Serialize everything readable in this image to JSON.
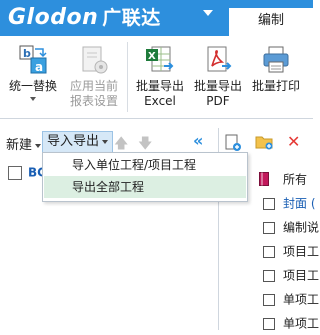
{
  "titlebar": {
    "logo_text": "Glodon",
    "logo_cn": "广联达",
    "tab_edit": "编制",
    "accent_color": "#2d8fdd"
  },
  "ribbon": {
    "buttons": [
      {
        "label_line1": "统一替换",
        "label_line2": "",
        "icon": "replace-icon"
      },
      {
        "label_line1": "应用当前",
        "label_line2": "报表设置",
        "icon": "apply-settings-icon"
      },
      {
        "label_line1": "批量导出",
        "label_line2": "Excel",
        "icon": "excel-export-icon"
      },
      {
        "label_line1": "批量导出",
        "label_line2": "PDF",
        "icon": "pdf-export-icon"
      },
      {
        "label_line1": "批量打印",
        "label_line2": "",
        "icon": "print-icon"
      }
    ]
  },
  "left_panel": {
    "new_label": "新建",
    "import_export_label": "导入导出",
    "tree_root_label": "BC"
  },
  "menu": {
    "items": [
      {
        "label": "导入单位工程/项目工程"
      },
      {
        "label": "导出全部工程"
      }
    ]
  },
  "right_panel": {
    "items": [
      {
        "label": "所有"
      },
      {
        "label": "封面 ("
      },
      {
        "label": "编制说"
      },
      {
        "label": "项目工"
      },
      {
        "label": "项目工"
      },
      {
        "label": "单项工"
      },
      {
        "label": "单项工"
      }
    ]
  }
}
